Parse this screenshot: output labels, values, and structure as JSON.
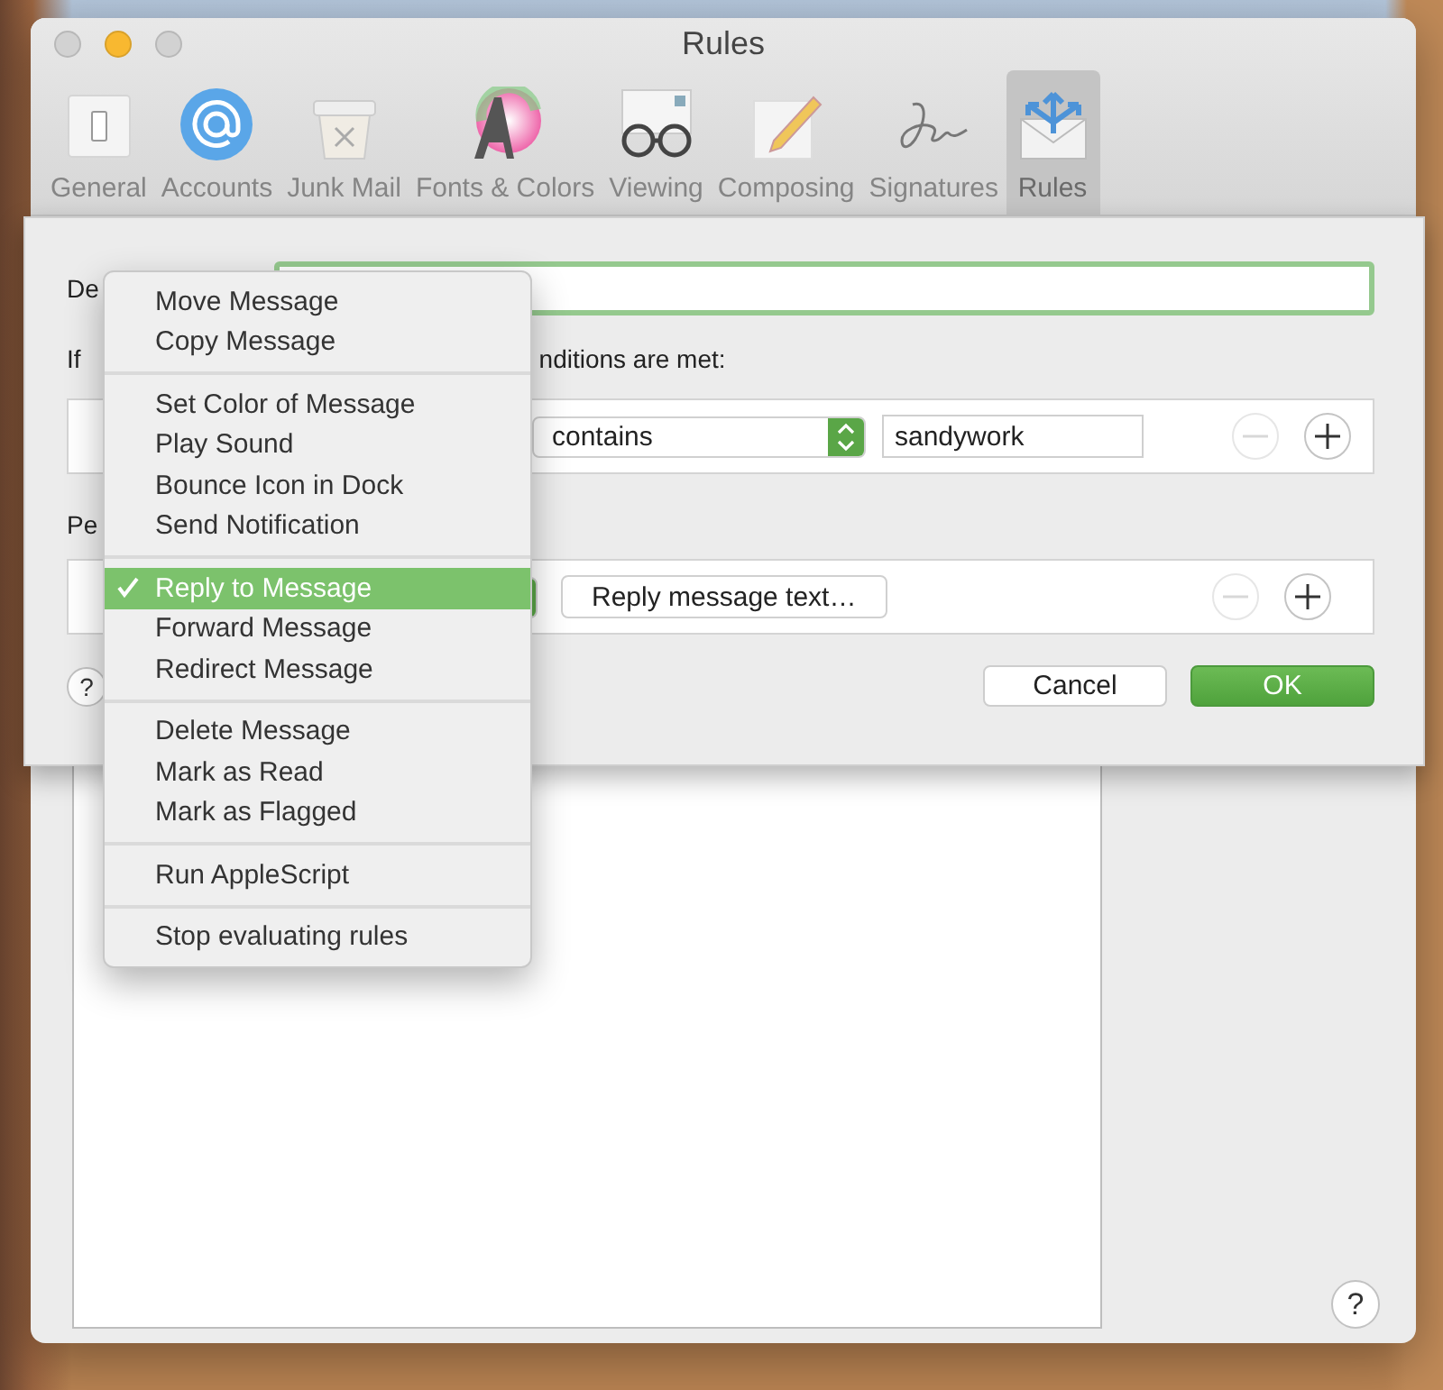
{
  "window": {
    "title": "Rules"
  },
  "toolbar": {
    "items": [
      {
        "label": "General",
        "selected": false
      },
      {
        "label": "Accounts",
        "selected": false
      },
      {
        "label": "Junk Mail",
        "selected": false
      },
      {
        "label": "Fonts & Colors",
        "selected": false
      },
      {
        "label": "Viewing",
        "selected": false
      },
      {
        "label": "Composing",
        "selected": false
      },
      {
        "label": "Signatures",
        "selected": false
      },
      {
        "label": "Rules",
        "selected": true
      }
    ]
  },
  "sheet": {
    "description_label": "De",
    "description_field": {
      "focused": true
    },
    "conditions_label_start": "If",
    "conditions_label_end": "nditions are met:",
    "condition": {
      "operator": "contains",
      "value": "sandywork",
      "remove_disabled": true
    },
    "actions_label": "Pe",
    "action": {
      "button": "Reply message text…",
      "remove_disabled": true
    },
    "buttons": [
      {
        "label": "Cancel",
        "default": false
      },
      {
        "label": "OK",
        "default": true
      }
    ]
  },
  "menu": {
    "groups": [
      [
        {
          "label": "Move Message",
          "checked": false,
          "selected": false
        },
        {
          "label": "Copy Message",
          "checked": false,
          "selected": false
        }
      ],
      [
        {
          "label": "Set Color of Message",
          "checked": false,
          "selected": false
        },
        {
          "label": "Play Sound",
          "checked": false,
          "selected": false
        },
        {
          "label": "Bounce Icon in Dock",
          "checked": false,
          "selected": false
        },
        {
          "label": "Send Notification",
          "checked": false,
          "selected": false
        }
      ],
      [
        {
          "label": "Reply to Message",
          "checked": true,
          "selected": true
        },
        {
          "label": "Forward Message",
          "checked": false,
          "selected": false
        },
        {
          "label": "Redirect Message",
          "checked": false,
          "selected": false
        }
      ],
      [
        {
          "label": "Delete Message",
          "checked": false,
          "selected": false
        },
        {
          "label": "Mark as Read",
          "checked": false,
          "selected": false
        },
        {
          "label": "Mark as Flagged",
          "checked": false,
          "selected": false
        }
      ],
      [
        {
          "label": "Run AppleScript",
          "checked": false,
          "selected": false
        }
      ],
      [
        {
          "label": "Stop evaluating rules",
          "checked": false,
          "selected": false
        }
      ]
    ]
  },
  "help_button": "?"
}
